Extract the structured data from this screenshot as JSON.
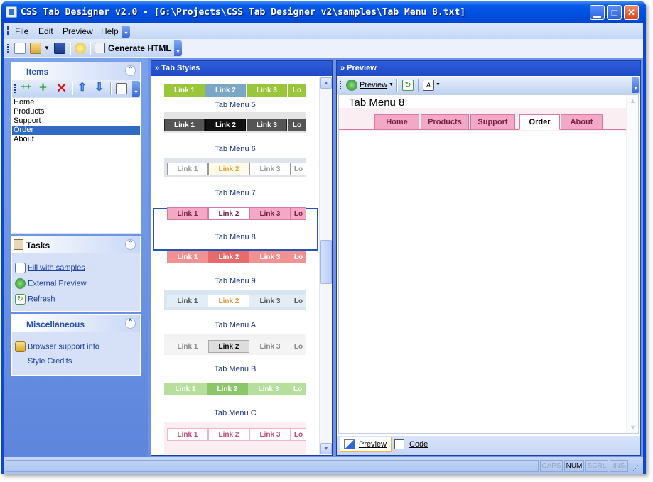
{
  "window": {
    "title": "CSS Tab Designer v2.0 - [G:\\Projects\\CSS Tab Designer v2\\samples\\Tab Menu 8.txt]",
    "minimize": "▁",
    "maximize": "□",
    "close": "✕"
  },
  "menu": {
    "file": "File",
    "edit": "Edit",
    "preview": "Preview",
    "help": "Help"
  },
  "toolbar": {
    "generate_label": "Generate HTML"
  },
  "items_panel": {
    "title": "Items",
    "items": [
      "Home",
      "Products",
      "Support",
      "Order",
      "About"
    ],
    "selected": "Order"
  },
  "tasks_panel": {
    "title": "Tasks",
    "fill_samples": "Fill with samples",
    "external_preview": "External Preview",
    "refresh": "Refresh"
  },
  "misc_panel": {
    "title": "Miscellaneous",
    "browser_support": "Browser support info",
    "style_credits": "Style Credits"
  },
  "tab_styles": {
    "title": "» Tab Styles",
    "link_labels": [
      "Link 1",
      "Link 2",
      "Link 3",
      "Lo"
    ],
    "styles": [
      {
        "caption": "Tab Menu 5"
      },
      {
        "caption": "Tab Menu 6"
      },
      {
        "caption": "Tab Menu 7"
      },
      {
        "caption": "Tab Menu 8"
      },
      {
        "caption": "Tab Menu 9"
      },
      {
        "caption": "Tab Menu A"
      },
      {
        "caption": "Tab Menu B"
      },
      {
        "caption": "Tab Menu C"
      }
    ],
    "selected": "Tab Menu 8"
  },
  "preview": {
    "title": "» Preview",
    "preview_button": "Preview",
    "heading": "Tab Menu 8",
    "tabs": [
      "Home",
      "Products",
      "Support",
      "Order",
      "About"
    ],
    "active_tab": "Order",
    "bottom_tabs": [
      "Preview",
      "Code"
    ]
  },
  "status": {
    "caps": "CAPS",
    "num": "NUM",
    "scrl": "SCRL",
    "ins": "INS"
  },
  "colors": {
    "title_blue": "#0050e0",
    "accent": "#316ac5",
    "pink_tab": "#f3a9c6"
  }
}
